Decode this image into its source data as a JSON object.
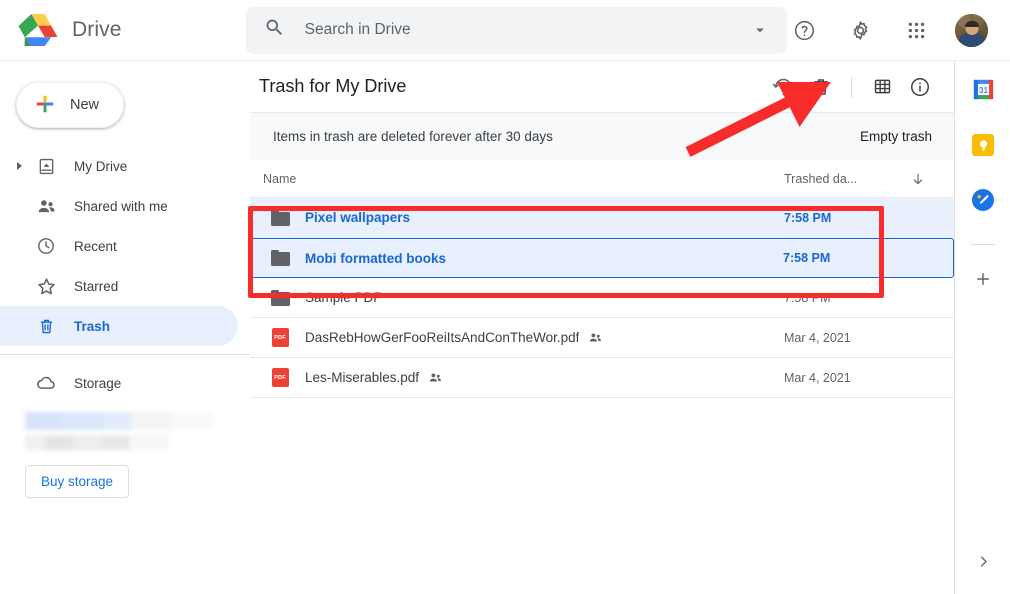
{
  "app": {
    "brand_name": "Drive",
    "logo_icon": "google-drive-logo"
  },
  "search": {
    "placeholder": "Search in Drive",
    "value": "",
    "search_icon": "search-icon",
    "options_icon": "chevron-down-icon"
  },
  "top_actions": [
    {
      "name": "help-icon",
      "label": "Support"
    },
    {
      "name": "gear-icon",
      "label": "Settings"
    },
    {
      "name": "apps-grid-icon",
      "label": "Google apps"
    },
    {
      "name": "avatar",
      "label": "Google Account"
    }
  ],
  "sidebar": {
    "new_button": {
      "label": "New",
      "icon": "plus-colored-icon"
    },
    "items": [
      {
        "label": "My Drive",
        "icon": "my-drive-icon",
        "expandable": true,
        "active": false
      },
      {
        "label": "Shared with me",
        "icon": "people-icon",
        "expandable": false,
        "active": false
      },
      {
        "label": "Recent",
        "icon": "clock-icon",
        "expandable": false,
        "active": false
      },
      {
        "label": "Starred",
        "icon": "star-icon",
        "expandable": false,
        "active": false
      },
      {
        "label": "Trash",
        "icon": "trash-icon",
        "expandable": false,
        "active": true
      }
    ],
    "storage": {
      "label": "Storage",
      "icon": "cloud-icon"
    },
    "buy_storage_label": "Buy storage"
  },
  "main": {
    "title": "Trash for My Drive",
    "header_actions": [
      {
        "name": "restore-from-trash-icon",
        "label": "Restore from trash"
      },
      {
        "name": "delete-forever-icon",
        "label": "Delete forever"
      },
      {
        "name": "grid-view-icon",
        "label": "Grid view"
      },
      {
        "name": "details-info-icon",
        "label": "View details"
      }
    ],
    "banner": {
      "text": "Items in trash are deleted forever after 30 days",
      "action_label": "Empty trash"
    },
    "columns": {
      "name": "Name",
      "trashed_date": "Trashed da...",
      "sort_icon": "arrow-down-icon"
    },
    "rows": [
      {
        "name": "Pixel wallpapers",
        "type": "folder",
        "icon": "folder-icon",
        "date": "7:58 PM",
        "selected": true,
        "focused": false,
        "shared": false
      },
      {
        "name": "Mobi formatted books",
        "type": "folder",
        "icon": "folder-icon",
        "date": "7:58 PM",
        "selected": true,
        "focused": true,
        "shared": false
      },
      {
        "name": "Sample PDF",
        "type": "folder",
        "icon": "folder-icon",
        "date": "7:58 PM",
        "selected": false,
        "focused": false,
        "shared": false
      },
      {
        "name": "DasRebHowGerFooReiItsAndConTheWor.pdf",
        "type": "pdf",
        "icon": "pdf-file-icon",
        "date": "Mar 4, 2021",
        "selected": false,
        "focused": false,
        "shared": true
      },
      {
        "name": "Les-Miserables.pdf",
        "type": "pdf",
        "icon": "pdf-file-icon",
        "date": "Mar 4, 2021",
        "selected": false,
        "focused": false,
        "shared": true
      }
    ],
    "pdf_badge_text": "PDF"
  },
  "right_panel": {
    "apps": [
      {
        "name": "google-calendar-icon",
        "label": "Calendar",
        "day": "31"
      },
      {
        "name": "google-keep-icon",
        "label": "Keep"
      },
      {
        "name": "google-tasks-icon",
        "label": "Tasks"
      }
    ],
    "add_app_icon": "plus-icon",
    "expand_icon": "chevron-right-icon"
  },
  "annotations": {
    "highlight_color": "#f92c2c",
    "arrow_target": "delete-forever-icon"
  }
}
